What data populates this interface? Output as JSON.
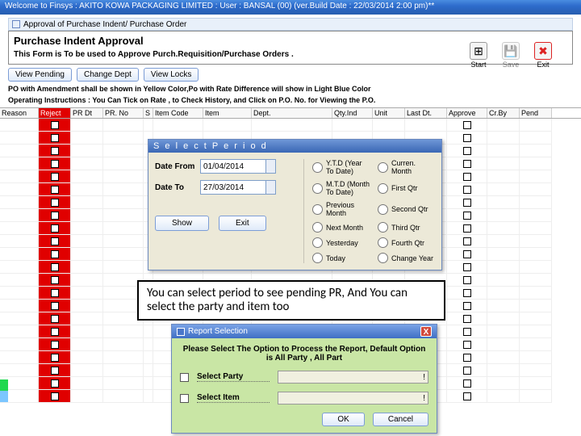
{
  "titlebar": "Welcome to Finsys : AKITO KOWA PACKAGING LIMITED : User : BANSAL (00) (ver.Build Date : 22/03/2014 2:00 pm)**",
  "subwin_title": "Approval of Purchase Indent/ Purchase Order",
  "panel": {
    "heading": "Purchase Indent Approval",
    "desc": "This Form is To be used to Approve Purch.Requisition/Purchase Orders ."
  },
  "iconbar": {
    "start": "Start",
    "save": "Save",
    "exit": "Exit"
  },
  "buttons": {
    "view_pending": "View Pending",
    "change_dept": "Change Dept",
    "view_locks": "View Locks"
  },
  "notes": {
    "line1": "PO with Amendment shall be shown in Yellow Color,Po with Rate Difference will show in Light Blue Color",
    "line2": "Operating Instructions : You Can Tick on Rate , to Check History, and Click on P.O. No. for Viewing the P.O."
  },
  "columns": [
    "Reason",
    "Reject",
    "PR Dt",
    "PR. No",
    "S",
    "Item Code",
    "Item",
    "Dept.",
    "Qty.Ind",
    "Unit",
    "Last Dt.",
    "Approve",
    "Cr.By",
    "Pend"
  ],
  "row_count": 22,
  "period_dialog": {
    "title": "S e l e c t   P e r i o d",
    "date_from_label": "Date From",
    "date_from": "01/04/2014",
    "date_to_label": "Date To",
    "date_to": "27/03/2014",
    "show": "Show",
    "exit": "Exit",
    "opts": {
      "ytd": "Y.T.D (Year To Date)",
      "mtd": "M.T.D (Month To Date)",
      "prev_month": "Previous Month",
      "next_month": "Next Month",
      "yesterday": "Yesterday",
      "today": "Today",
      "curr_month": "Curren. Month",
      "q1": "First Qtr",
      "q2": "Second Qtr",
      "q3": "Third Qtr",
      "q4": "Fourth Qtr",
      "change_year": "Change Year"
    }
  },
  "annotation": "You can select period to see pending PR, And You can select the party and item too",
  "report_dialog": {
    "title": "Report Selection",
    "instr": "Please Select The Option to Process the Report, Default Option is All Party , All Part",
    "select_party": "Select Party",
    "select_item": "Select Item",
    "ok": "OK",
    "cancel": "Cancel",
    "excl": "!"
  },
  "close_x": "X",
  "colors": {
    "reject_red": "#e00000",
    "dialog_green": "#c9e6a5"
  }
}
